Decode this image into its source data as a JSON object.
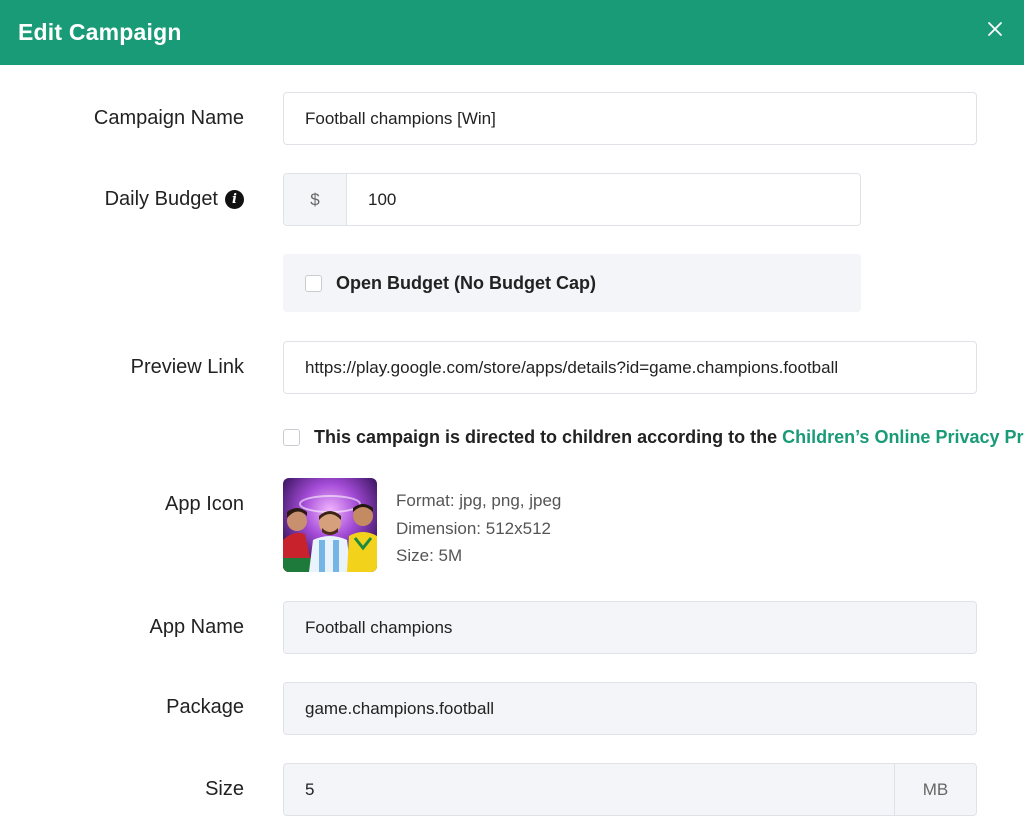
{
  "header": {
    "title": "Edit Campaign",
    "close_icon": "close-icon"
  },
  "form": {
    "campaign_name": {
      "label": "Campaign Name",
      "value": "Football champions [Win]"
    },
    "daily_budget": {
      "label": "Daily Budget",
      "info_icon": "info-icon",
      "currency": "$",
      "value": "100"
    },
    "open_budget": {
      "label": "Open Budget (No Budget Cap)",
      "checked": false
    },
    "preview_link": {
      "label": "Preview Link",
      "value": "https://play.google.com/store/apps/details?id=game.champions.football"
    },
    "children": {
      "text": "This campaign is directed to children according to the ",
      "link_text": "Children’s Online Privacy Pr",
      "checked": false
    },
    "app_icon": {
      "label": "App Icon",
      "format": "Format: jpg, png, jpeg",
      "dimension": "Dimension: 512x512",
      "size": "Size: 5M"
    },
    "app_name": {
      "label": "App Name",
      "value": "Football champions"
    },
    "package": {
      "label": "Package",
      "value": "game.champions.football"
    },
    "size": {
      "label": "Size",
      "value": "5",
      "unit": "MB"
    }
  },
  "colors": {
    "accent": "#1a9b78",
    "readonly_bg": "#f4f5f8",
    "border": "#dfe2e6"
  }
}
